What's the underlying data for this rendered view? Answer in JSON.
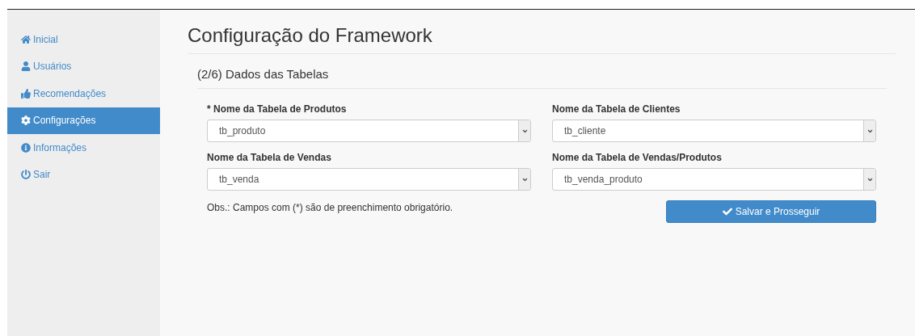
{
  "sidebar": {
    "items": [
      {
        "label": "Inicial",
        "selected": false
      },
      {
        "label": "Usuários",
        "selected": false
      },
      {
        "label": "Recomendações",
        "selected": false
      },
      {
        "label": "Configurações",
        "selected": true
      },
      {
        "label": "Informações",
        "selected": false
      },
      {
        "label": "Sair",
        "selected": false
      }
    ]
  },
  "page_title": "Configuração do Framework",
  "section_title": "(2/6) Dados das Tabelas",
  "fields": [
    {
      "label": "* Nome da Tabela de Produtos",
      "value": "tb_produto"
    },
    {
      "label": "Nome da Tabela de Clientes",
      "value": "tb_cliente"
    },
    {
      "label": "Nome da Tabela de Vendas",
      "value": "tb_venda"
    },
    {
      "label": "Nome da Tabela de Vendas/Produtos",
      "value": "tb_venda_produto"
    }
  ],
  "note": "Obs.: Campos com (*) são de preenchimento obrigatório.",
  "submit_button": "Salvar e Prosseguir"
}
